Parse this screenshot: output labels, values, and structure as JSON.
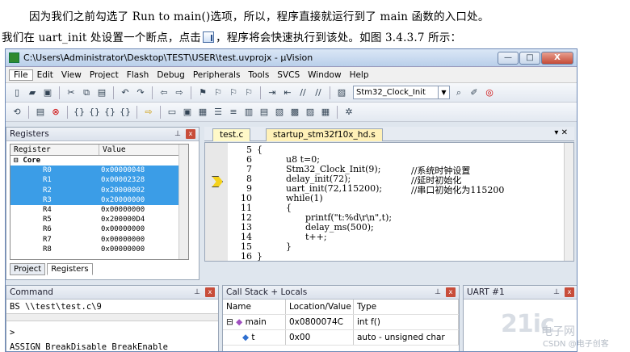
{
  "paragraph": {
    "line1": "因为我们之前勾选了 Run to main()选项，所以，程序直接就运行到了 main 函数的入口处。",
    "line2_a": "我们在 uart_init 处设置一个断点，点击",
    "line2_b": "，程序将会快速执行到该处。如图 3.4.3.7 所示："
  },
  "window": {
    "title": "C:\\Users\\Administrator\\Desktop\\TEST\\USER\\test.uvprojx - µVision",
    "controls": [
      "—",
      "□",
      "X"
    ]
  },
  "menu": [
    "File",
    "Edit",
    "View",
    "Project",
    "Flash",
    "Debug",
    "Peripherals",
    "Tools",
    "SVCS",
    "Window",
    "Help"
  ],
  "toolbar": {
    "target_combo": "Stm32_Clock_Init"
  },
  "registers": {
    "title": "Registers",
    "col_register": "Register",
    "col_value": "Value",
    "group": "Core",
    "rows": [
      {
        "name": "R0",
        "value": "0x00000048",
        "selected": true
      },
      {
        "name": "R1",
        "value": "0x00002328",
        "selected": true
      },
      {
        "name": "R2",
        "value": "0x20000002",
        "selected": true
      },
      {
        "name": "R3",
        "value": "0x20000000",
        "selected": true
      },
      {
        "name": "R4",
        "value": "0x00000000",
        "selected": false
      },
      {
        "name": "R5",
        "value": "0x200000D4",
        "selected": false
      },
      {
        "name": "R6",
        "value": "0x00000000",
        "selected": false
      },
      {
        "name": "R7",
        "value": "0x00000000",
        "selected": false
      },
      {
        "name": "R8",
        "value": "0x00000000",
        "selected": false
      }
    ],
    "tabs": [
      "Project",
      "Registers"
    ]
  },
  "editor": {
    "tabs": [
      "test.c",
      "startup_stm32f10x_hd.s"
    ],
    "line_numbers": [
      "5",
      "6",
      "7",
      "8",
      "9",
      "10",
      "11",
      "12",
      "13",
      "14",
      "15",
      "16"
    ],
    "lines": {
      "l5": "{",
      "l6": "u8 t=0;",
      "l7a": "Stm32_Clock_Init(9);",
      "l7c": "//系统时钟设置",
      "l8a": "delay_init(72);",
      "l8c": "//延时初始化",
      "l9a": "uart_init(72,115200);",
      "l9c": "//串口初始化为115200",
      "l10": "while(1)",
      "l11": "{",
      "l12": "printf(\"t:%d\\r\\n\",t);",
      "l13": "delay_ms(500);",
      "l14": "t++;",
      "l15": "}",
      "l16": "}"
    }
  },
  "command": {
    "title": "Command",
    "output": "BS \\\\test\\test.c\\9",
    "prompt": ">",
    "hint": "ASSIGN BreakDisable BreakEnable"
  },
  "callstack": {
    "title": "Call Stack + Locals",
    "headers": [
      "Name",
      "Location/Value",
      "Type"
    ],
    "rows": [
      {
        "name": "main",
        "value": "0x0800074C",
        "type": "int f()"
      },
      {
        "name": "t",
        "value": "0x00",
        "type": "auto - unsigned char"
      }
    ]
  },
  "uart": {
    "title": "UART #1"
  },
  "watermark": {
    "big": "21ic",
    "small": "电子网",
    "url": "CSDN @电子创客"
  }
}
